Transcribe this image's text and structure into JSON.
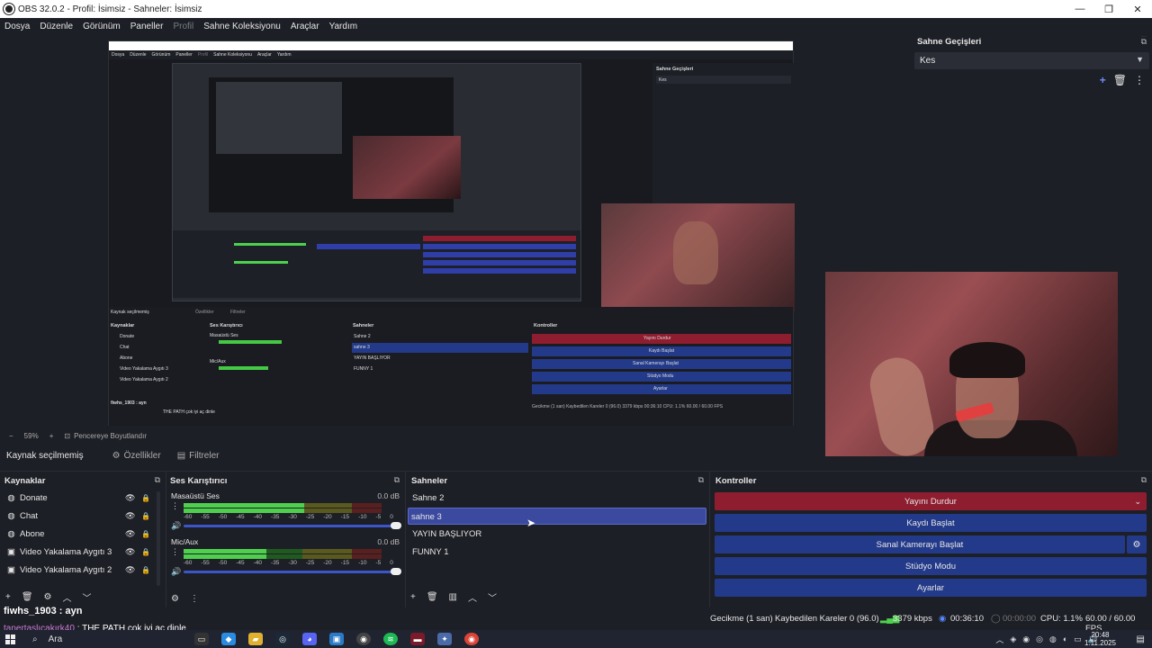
{
  "window": {
    "title": "OBS 32.0.2 - Profil: İsimsiz - Sahneler: İsimsiz",
    "minimize": "—",
    "maximize": "❐",
    "close": "✕"
  },
  "menu": [
    {
      "label": "Dosya"
    },
    {
      "label": "Düzenle"
    },
    {
      "label": "Görünüm"
    },
    {
      "label": "Paneller"
    },
    {
      "label": "Profil"
    },
    {
      "label": "Sahne Koleksiyonu"
    },
    {
      "label": "Araçlar"
    },
    {
      "label": "Yardım"
    }
  ],
  "nested_preview": {
    "menu": [
      "Dosya",
      "Düzenle",
      "Görünüm",
      "Paneller",
      "Profil",
      "Sahne Koleksiyonu",
      "Araçlar",
      "Yardım"
    ],
    "transitions_label": "Sahne Geçişleri",
    "transition_value": "Kes",
    "source_none": "Kaynak seçilmemiş",
    "props": "Özellikler",
    "filters": "Filtreler",
    "panels": {
      "sources": "Kaynaklar",
      "mixer": "Ses Karıştırıcı",
      "scenes": "Sahneler",
      "controls": "Kontroller"
    },
    "sources": [
      "Donate",
      "Chat",
      "Abone",
      "Video Yakalama Aygıtı 3",
      "Video Yakalama Aygıtı 2"
    ],
    "scenes": [
      "Sahne 2",
      "sahne 3",
      "YAYIN BAŞLIYOR",
      "FUNNY 1"
    ],
    "controls": [
      "Yayını Durdur",
      "Kaydı Başlat",
      "Sanal Kamerayı Başlat",
      "Stüdyo Modu",
      "Ayarlar"
    ],
    "mixer_channels": [
      "Masaüstü Ses",
      "Mic/Aux"
    ],
    "status": "Gecikme (1 san)    Kaybedilen Kareler 0 (96.0)    3379 kbps    00:36:10    CPU: 1.1%    60.00 / 60.00 FPS",
    "chat1": "fiwhs_1903 : ayn",
    "chat2": "THE PATH çok iyi aç dinle",
    "zoom": "59%",
    "fit": "Pencereye Boyutlandır"
  },
  "preview_bar": {
    "minus": "−",
    "zoom": "59%",
    "plus": "+",
    "fit_label": "Pencereye Boyutlandır",
    "fit_icon": "⊡"
  },
  "transitions": {
    "title": "Sahne Geçişleri",
    "selected": "Kes",
    "add": "+",
    "delete": "🗑",
    "more": "⋮"
  },
  "source_bar": {
    "label": "Kaynak seçilmemiş",
    "properties": "Özellikler",
    "filters": "Filtreler"
  },
  "sources_panel": {
    "title": "Kaynaklar",
    "items": [
      {
        "name": "Donate",
        "icon": "globe-icon"
      },
      {
        "name": "Chat",
        "icon": "globe-icon"
      },
      {
        "name": "Abone",
        "icon": "globe-icon"
      },
      {
        "name": "Video Yakalama Aygıtı 3",
        "icon": "camera-icon"
      },
      {
        "name": "Video Yakalama Aygıtı 2",
        "icon": "camera-icon"
      }
    ]
  },
  "mixer_panel": {
    "title": "Ses Karıştırıcı",
    "channels": [
      {
        "name": "Masaüstü Ses",
        "db": "0.0 dB",
        "level": 0.61
      },
      {
        "name": "Mic/Aux",
        "db": "0.0 dB",
        "level": 0.42
      }
    ],
    "ticks": [
      "-60",
      "-55",
      "-50",
      "-45",
      "-40",
      "-35",
      "-30",
      "-25",
      "-20",
      "-15",
      "-10",
      "-5",
      "0"
    ]
  },
  "scenes_panel": {
    "title": "Sahneler",
    "items": [
      {
        "name": "Sahne 2"
      },
      {
        "name": "sahne 3"
      },
      {
        "name": "YAYIN BAŞLIYOR"
      },
      {
        "name": "FUNNY 1"
      }
    ]
  },
  "controls_panel": {
    "title": "Kontroller",
    "stop_stream": "Yayını Durdur",
    "start_record": "Kaydı Başlat",
    "start_virtualcam": "Sanal Kamerayı Başlat",
    "studio_mode": "Stüdyo Modu",
    "settings": "Ayarlar"
  },
  "status_bar": {
    "delay": "Gecikme (1 san)",
    "dropped": "Kaybedilen Kareler 0 (96.0)",
    "bitrate": "3379 kbps",
    "stream_time": "00:36:10",
    "record_time": "00:00:00",
    "cpu": "CPU: 1.1%",
    "fps": "60.00 / 60.00 FPS"
  },
  "chat_overlay": {
    "line1": "fiwhs_1903 : ayn",
    "line2_user": "tanertaşlıçakırk40",
    "line2_text": " : THE PATH çok iyi aç dinle"
  },
  "taskbar": {
    "search": "Ara",
    "time": "20:48",
    "date": "1.11.2025"
  },
  "colors": {
    "accent": "#233a8a",
    "stop": "#8f1d30",
    "selected_scene": "#3b4a9f",
    "meter_green": "#4ed04e"
  }
}
